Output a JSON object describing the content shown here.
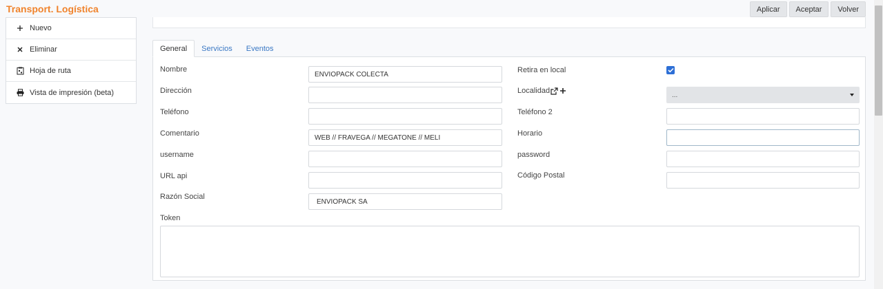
{
  "header": {
    "title": "Transport. Logística"
  },
  "actions": {
    "apply": "Aplicar",
    "accept": "Aceptar",
    "back": "Volver"
  },
  "sidebar": {
    "items": [
      {
        "label": "Nuevo",
        "icon": "plus-icon"
      },
      {
        "label": "Eliminar",
        "icon": "close-icon"
      },
      {
        "label": "Hoja de ruta",
        "icon": "route-sheet-icon"
      },
      {
        "label": "Vista de impresión (beta)",
        "icon": "printer-icon"
      }
    ]
  },
  "tabs": [
    {
      "label": "General",
      "active": true
    },
    {
      "label": "Servicios",
      "active": false
    },
    {
      "label": "Eventos",
      "active": false
    }
  ],
  "form": {
    "nombre": {
      "label": "Nombre",
      "value": "ENVIOPACK COLECTA"
    },
    "direccion": {
      "label": "Dirección",
      "value": ""
    },
    "telefono": {
      "label": "Teléfono",
      "value": ""
    },
    "comentario": {
      "label": "Comentario",
      "value": "WEB // FRAVEGA // MEGATONE // MELI"
    },
    "username": {
      "label": "username",
      "value": ""
    },
    "url_api": {
      "label": "URL api",
      "value": ""
    },
    "razon_social": {
      "label": "Razón Social",
      "value": "ENVIOPACK SA"
    },
    "token": {
      "label": "Token",
      "value": ""
    },
    "retira_local": {
      "label": "Retira en local",
      "checked": true
    },
    "localidad": {
      "label": "Localidad",
      "value": "..."
    },
    "telefono2": {
      "label": "Teléfono 2",
      "value": ""
    },
    "horario": {
      "label": "Horario",
      "value": ""
    },
    "password": {
      "label": "password",
      "value": ""
    },
    "codigo_postal": {
      "label": "Código Postal",
      "value": ""
    }
  },
  "colors": {
    "brand": "#f0832c",
    "link": "#3a78c4",
    "checkbox": "#2d6fd6"
  }
}
